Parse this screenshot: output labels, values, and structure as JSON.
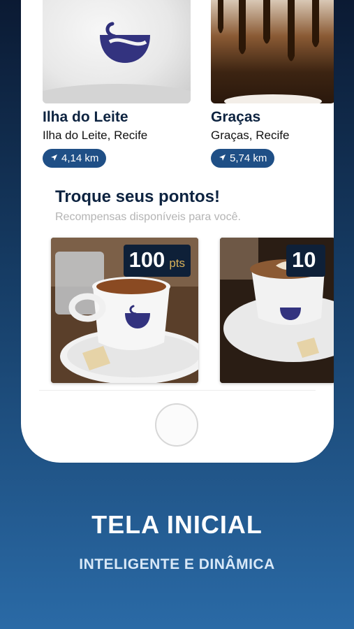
{
  "stores": [
    {
      "name": "Ilha do Leite",
      "address": "Ilha do Leite, Recife",
      "distance": "4,14 km"
    },
    {
      "name": "Graças",
      "address": "Graças, Recife",
      "distance": "5,74 km"
    }
  ],
  "rewards": {
    "title": "Troque seus pontos!",
    "subtitle": "Recompensas disponíveis para você.",
    "items": [
      {
        "points": "100",
        "unit": "pts"
      },
      {
        "points": "10",
        "unit": ""
      }
    ]
  },
  "caption": {
    "title": "TELA INICIAL",
    "subtitle": "INTELIGENTE E DINÂMICA"
  },
  "colors": {
    "brand_navy": "#0d2340",
    "badge_blue": "#1f4f86",
    "points_gold": "#d9b25a"
  }
}
